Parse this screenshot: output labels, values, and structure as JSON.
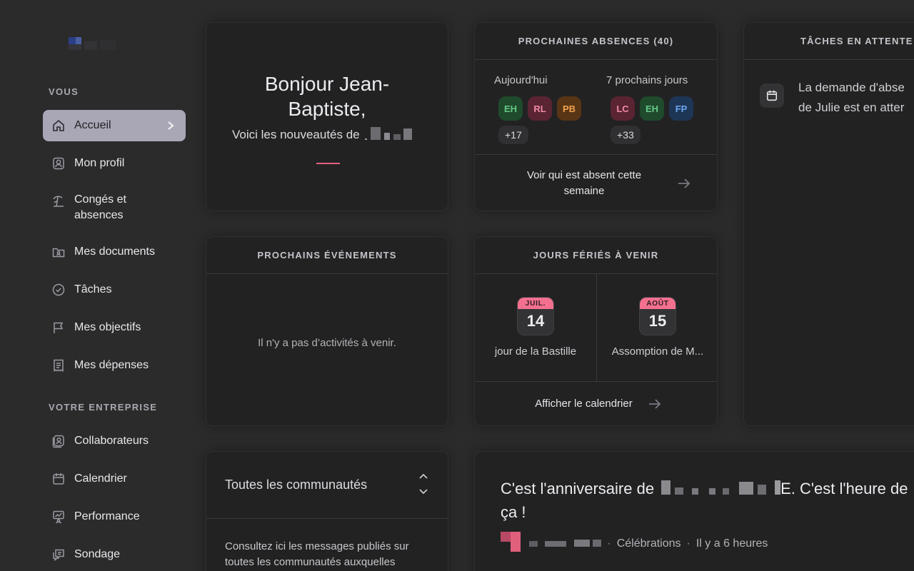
{
  "sidebar": {
    "you_label": "VOUS",
    "company_label": "VOTRE ENTREPRISE",
    "you_items": [
      {
        "label": "Accueil",
        "icon": "home-icon"
      },
      {
        "label": "Mon profil",
        "icon": "profile-icon"
      },
      {
        "label": "Congés et absences",
        "icon": "beach-icon"
      },
      {
        "label": "Mes documents",
        "icon": "folder-icon"
      },
      {
        "label": "Tâches",
        "icon": "check-circle-icon"
      },
      {
        "label": "Mes objectifs",
        "icon": "flag-icon"
      },
      {
        "label": "Mes dépenses",
        "icon": "receipt-icon"
      }
    ],
    "company_items": [
      {
        "label": "Collaborateurs",
        "icon": "people-icon"
      },
      {
        "label": "Calendrier",
        "icon": "calendar-icon"
      },
      {
        "label": "Performance",
        "icon": "performance-icon"
      },
      {
        "label": "Sondage",
        "icon": "survey-icon"
      }
    ]
  },
  "greeting": {
    "line1": "Bonjour Jean-",
    "line2": "Baptiste,",
    "subtitle": "Voici les nouveautés de"
  },
  "absences": {
    "title": "PROCHAINES ABSENCES (40)",
    "today_label": "Aujourd'hui",
    "week_label": "7 prochains jours",
    "today_avatars": [
      "EH",
      "RL",
      "PB"
    ],
    "today_more": "+17",
    "week_avatars": [
      "LC",
      "EH",
      "FP"
    ],
    "week_more": "+33",
    "link": "Voir qui est absent cette semaine"
  },
  "tasks": {
    "title": "TÂCHES EN ATTENTE",
    "line1": "La demande d'abse",
    "line2": "de Julie est en atter"
  },
  "events": {
    "title": "PROCHAINS ÉVÉNEMENTS",
    "empty": "Il n'y a pas d’activités à venir."
  },
  "holidays": {
    "title": "JOURS FÉRIÉS À VENIR",
    "items": [
      {
        "month": "JUIL.",
        "day": "14",
        "name": "jour de la Bastille"
      },
      {
        "month": "AOÛT",
        "day": "15",
        "name": "Assomption de M..."
      }
    ],
    "link": "Afficher le calendrier"
  },
  "communities": {
    "title": "Toutes les communautés",
    "text": "Consultez ici les messages publiés sur toutes les communautés auxquelles"
  },
  "post": {
    "title_start": "C'est l'anniversaire de",
    "title_mid": "E. C'est l'heure de",
    "title_end": "ça !",
    "category": "Célébrations",
    "time": "Il y a 6 heures"
  },
  "colors": {
    "accent_pink": "#f3708f",
    "active_nav": "#a9a7b6"
  }
}
